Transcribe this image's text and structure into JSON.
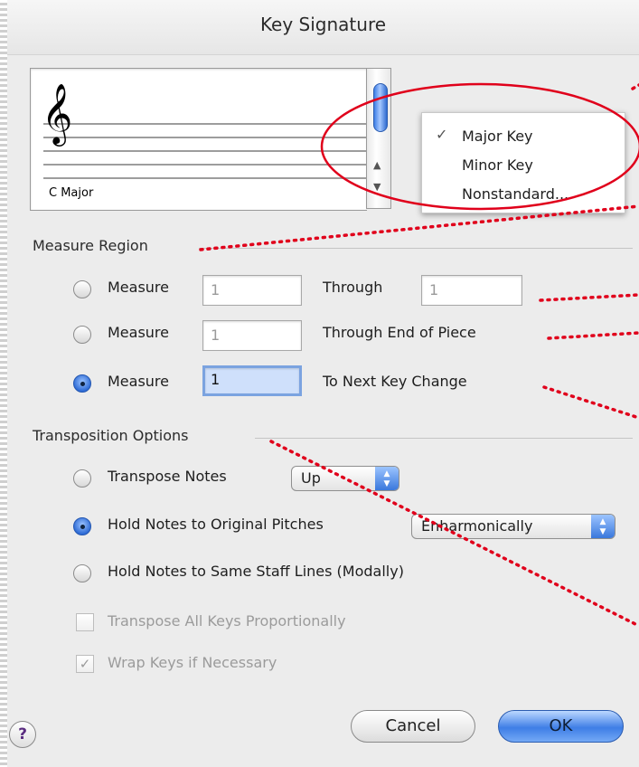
{
  "dialog": {
    "title": "Key Signature"
  },
  "preview": {
    "key_label": "C Major",
    "clef_icon": "treble-clef-icon"
  },
  "key_menu": {
    "items": [
      {
        "label": "Major Key",
        "checked": true
      },
      {
        "label": "Minor Key",
        "checked": false
      },
      {
        "label": "Nonstandard...",
        "checked": false
      }
    ],
    "check_glyph": "✓"
  },
  "measure_region": {
    "section_label": "Measure Region",
    "rows": [
      {
        "radio_label": "Measure",
        "from_value": "1",
        "range_label": "Through",
        "to_value": "1",
        "selected": false
      },
      {
        "radio_label": "Measure",
        "from_value": "1",
        "range_label": "Through End of Piece",
        "selected": false
      },
      {
        "radio_label": "Measure",
        "from_value": "1",
        "range_label": "To Next Key Change",
        "selected": true
      }
    ]
  },
  "transposition": {
    "section_label": "Transposition Options",
    "transpose_notes_label": "Transpose Notes",
    "direction_value": "Up",
    "hold_original_label": "Hold Notes to Original Pitches",
    "hold_original_mode": "Enharmonically",
    "hold_staff_lines_label": "Hold Notes to Same Staff Lines (Modally)",
    "selected_option": "hold_original",
    "transpose_all_label": "Transpose All Keys Proportionally",
    "transpose_all_checked": false,
    "wrap_keys_label": "Wrap Keys if Necessary",
    "wrap_keys_checked": true
  },
  "buttons": {
    "cancel": "Cancel",
    "ok": "OK",
    "help": "?"
  },
  "colors": {
    "annotation": "#e0001b",
    "accent": "#3e7ee6"
  }
}
